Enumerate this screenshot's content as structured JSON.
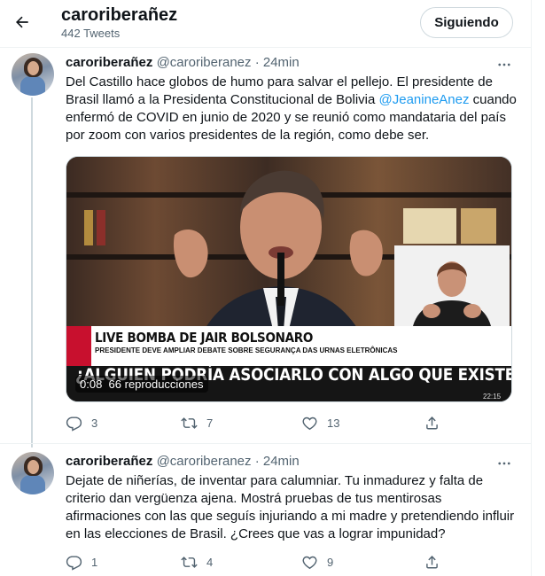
{
  "header": {
    "title": "caroriberañez",
    "subtitle": "442 Tweets",
    "follow_label": "Siguiendo"
  },
  "tweets": [
    {
      "name": "caroriberañez",
      "handle": "@caroriberanez",
      "dot": "·",
      "time": "24min",
      "text_lines": [
        "Del Castillo hace globos de humo para salvar el pellejo. El presidente de",
        "Brasil llamó a la Presidenta Constitucional de Bolivia ",
        "enfermó de COVID en junio de 2020 y se reunió como mandataria del país",
        "por zoom con varios presidentes de la región, como debe ser."
      ],
      "mention": "@JeanineAnez",
      "after_mention": " cuando",
      "media": {
        "live_label": "LIVE BOMBA DE JAIR BOLSONARO",
        "sub_label": "PRESIDENTE DEVE AMPLIAR DEBATE SOBRE SEGURANÇA DAS URNAS ELETRÔNICAS",
        "headline": "¿ALGUIEN PODRÍA ASOCIARLO CON ALGO QUE EXISTE EN BRASIL?",
        "duration": "0:08",
        "views": "66 reproducciones",
        "stamp": "22:15"
      },
      "replies": "3",
      "retweets": "7",
      "likes": "13"
    },
    {
      "name": "caroriberañez",
      "handle": "@caroriberanez",
      "dot": "·",
      "time": "24min",
      "text_lines": [
        "Dejate de niñerías, de inventar para calumniar. Tu inmadurez y falta de",
        "criterio dan vergüenza ajena. Mostrá pruebas de tus mentirosas",
        "afirmaciones con las que seguís injuriando a mi madre y pretendiendo influir",
        "en las elecciones de Brasil. ¿Crees que vas a lograr impunidad?"
      ],
      "replies": "1",
      "retweets": "4",
      "likes": "9"
    }
  ],
  "colors": {
    "accent": "#1d9bf0",
    "text": "#0f1419",
    "secondary": "#536471",
    "border": "#eff3f4"
  },
  "icons": [
    "back-arrow-icon",
    "more-icon",
    "reply-icon",
    "retweet-icon",
    "like-icon",
    "share-icon"
  ]
}
